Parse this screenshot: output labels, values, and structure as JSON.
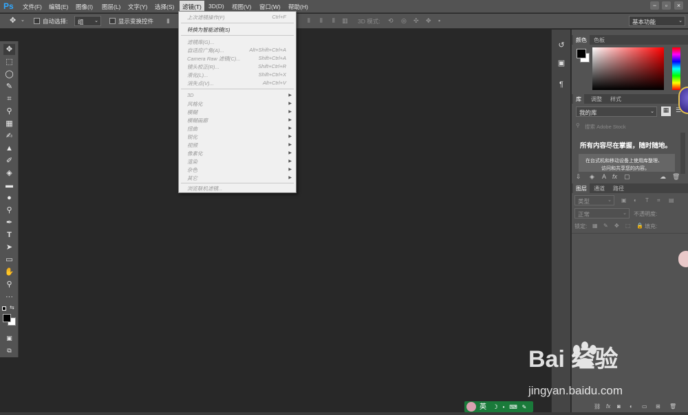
{
  "app": {
    "logo": "Ps"
  },
  "menubar": {
    "items": [
      "文件(F)",
      "编辑(E)",
      "图像(I)",
      "图层(L)",
      "文字(Y)",
      "选择(S)",
      "滤镜(T)",
      "3D(D)",
      "视图(V)",
      "窗口(W)",
      "帮助(H)"
    ],
    "active": "滤镜(T)",
    "win_min": "−",
    "win_max": "▫",
    "win_close": "×"
  },
  "options": {
    "move_icon": "move-icon",
    "auto_select_label": "自动选择:",
    "auto_select_value": "组",
    "show_transform_label": "显示变换控件",
    "mode_3d_label": "3D 模式:",
    "workspace": "基本功能"
  },
  "filter_menu": {
    "items": [
      {
        "label": "上次滤镜操作(F)",
        "shortcut": "Ctrl+F",
        "state": "disabled"
      },
      {
        "label": "转换为智能滤镜(S)",
        "shortcut": "",
        "state": "enabled"
      },
      {
        "label": "滤镜库(G)...",
        "shortcut": "",
        "state": "disabled"
      },
      {
        "label": "自适应广角(A)...",
        "shortcut": "Alt+Shift+Ctrl+A",
        "state": "disabled"
      },
      {
        "label": "Camera Raw 滤镜(C)...",
        "shortcut": "Shift+Ctrl+A",
        "state": "disabled"
      },
      {
        "label": "镜头校正(R)...",
        "shortcut": "Shift+Ctrl+R",
        "state": "disabled"
      },
      {
        "label": "液化(L)...",
        "shortcut": "Shift+Ctrl+X",
        "state": "disabled"
      },
      {
        "label": "消失点(V)...",
        "shortcut": "Alt+Ctrl+V",
        "state": "disabled"
      },
      {
        "label": "3D",
        "submenu": true,
        "state": "disabled"
      },
      {
        "label": "风格化",
        "submenu": true,
        "state": "disabled"
      },
      {
        "label": "模糊",
        "submenu": true,
        "state": "disabled"
      },
      {
        "label": "模糊画廊",
        "submenu": true,
        "state": "disabled"
      },
      {
        "label": "扭曲",
        "submenu": true,
        "state": "disabled"
      },
      {
        "label": "锐化",
        "submenu": true,
        "state": "disabled"
      },
      {
        "label": "视频",
        "submenu": true,
        "state": "disabled"
      },
      {
        "label": "像素化",
        "submenu": true,
        "state": "disabled"
      },
      {
        "label": "渲染",
        "submenu": true,
        "state": "disabled"
      },
      {
        "label": "杂色",
        "submenu": true,
        "state": "disabled"
      },
      {
        "label": "其它",
        "submenu": true,
        "state": "disabled"
      },
      {
        "label": "浏览联机滤镜...",
        "shortcut": "",
        "state": "disabled"
      }
    ]
  },
  "color_panel": {
    "tabs": [
      "颜色",
      "色板"
    ],
    "active_tab": "颜色",
    "accent_color": "#ff0000"
  },
  "library_panel": {
    "tabs": [
      "库",
      "调整",
      "样式"
    ],
    "active_tab": "库",
    "library_select": "我的库",
    "search_placeholder": "搜索 Adobe Stock",
    "headline": "所有内容尽在掌握，随时随地。",
    "desc_line1": "在台式机和移动设备上使用库整理、",
    "desc_line2": "访问和共享您的内容。"
  },
  "layers_panel": {
    "tabs": [
      "图层",
      "通道",
      "路径"
    ],
    "active_tab": "图层",
    "kind_filter": "类型",
    "blend_mode": "正常",
    "opacity_label": "不透明度:",
    "lock_label": "锁定:",
    "fill_label": "填充:"
  },
  "ime": {
    "label": "英"
  },
  "watermark": {
    "logo": "Bai  经验",
    "url": "jingyan.baidu.com"
  }
}
